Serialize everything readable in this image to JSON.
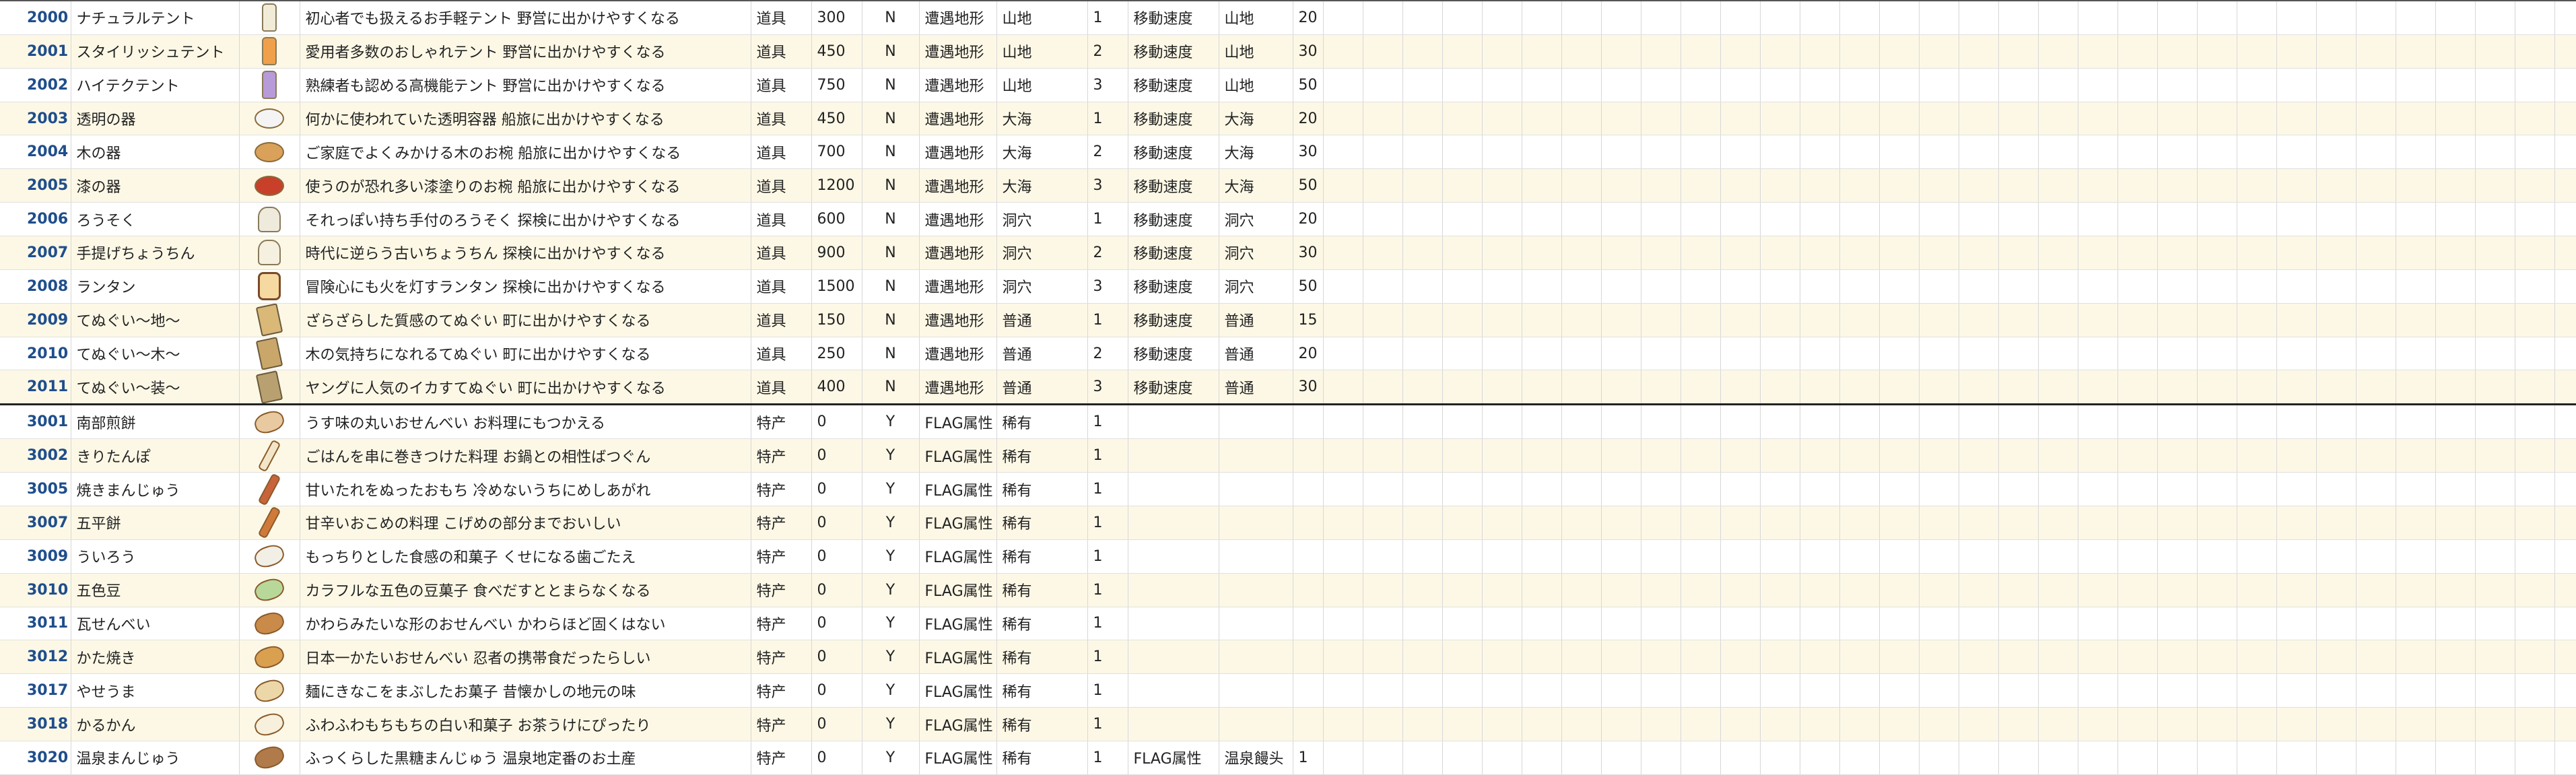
{
  "rows": [
    {
      "id": "2000",
      "name": "ナチュラルテント",
      "icon": "tent-bottle-icon",
      "iconColor": "#f1ecd8",
      "desc": "初心者でも扱えるお手軽テント 野営に出かけやすくなる",
      "type": "道具",
      "price": "300",
      "flag": "N",
      "cat": "遭遇地形",
      "terrain": "山地",
      "lv": "1",
      "effect": "移動速度",
      "target": "山地",
      "value": "20"
    },
    {
      "id": "2001",
      "name": "スタイリッシュテント",
      "icon": "tent-bottle-icon",
      "iconColor": "#f0a04a",
      "desc": "愛用者多数のおしゃれテント 野営に出かけやすくなる",
      "type": "道具",
      "price": "450",
      "flag": "N",
      "cat": "遭遇地形",
      "terrain": "山地",
      "lv": "2",
      "effect": "移動速度",
      "target": "山地",
      "value": "30"
    },
    {
      "id": "2002",
      "name": "ハイテクテント",
      "icon": "tent-bottle-icon",
      "iconColor": "#b79ad8",
      "desc": "熟練者も認める高機能テント 野営に出かけやすくなる",
      "type": "道具",
      "price": "750",
      "flag": "N",
      "cat": "遭遇地形",
      "terrain": "山地",
      "lv": "3",
      "effect": "移動速度",
      "target": "山地",
      "value": "50"
    },
    {
      "id": "2003",
      "name": "透明の器",
      "icon": "bowl-icon",
      "iconColor": "#f4f4f4",
      "desc": "何かに使われていた透明容器 船旅に出かけやすくなる",
      "type": "道具",
      "price": "450",
      "flag": "N",
      "cat": "遭遇地形",
      "terrain": "大海",
      "lv": "1",
      "effect": "移動速度",
      "target": "大海",
      "value": "20"
    },
    {
      "id": "2004",
      "name": "木の器",
      "icon": "bowl-icon",
      "iconColor": "#d9a15a",
      "desc": "ご家庭でよくみかける木のお椀 船旅に出かけやすくなる",
      "type": "道具",
      "price": "700",
      "flag": "N",
      "cat": "遭遇地形",
      "terrain": "大海",
      "lv": "2",
      "effect": "移動速度",
      "target": "大海",
      "value": "30"
    },
    {
      "id": "2005",
      "name": "漆の器",
      "icon": "bowl-icon",
      "iconColor": "#c8402a",
      "desc": "使うのが恐れ多い漆塗りのお椀 船旅に出かけやすくなる",
      "type": "道具",
      "price": "1200",
      "flag": "N",
      "cat": "遭遇地形",
      "terrain": "大海",
      "lv": "3",
      "effect": "移動速度",
      "target": "大海",
      "value": "50"
    },
    {
      "id": "2006",
      "name": "ろうそく",
      "icon": "candle-icon",
      "iconColor": "#eeeadc",
      "desc": "それっぽい持ち手付のろうそく 探検に出かけやすくなる",
      "type": "道具",
      "price": "600",
      "flag": "N",
      "cat": "遭遇地形",
      "terrain": "洞穴",
      "lv": "1",
      "effect": "移動速度",
      "target": "洞穴",
      "value": "20"
    },
    {
      "id": "2007",
      "name": "手提げちょうちん",
      "icon": "candle-icon",
      "iconColor": "#f5f0e0",
      "desc": "時代に逆らう古いちょうちん 探検に出かけやすくなる",
      "type": "道具",
      "price": "900",
      "flag": "N",
      "cat": "遭遇地形",
      "terrain": "洞穴",
      "lv": "2",
      "effect": "移動速度",
      "target": "洞穴",
      "value": "30"
    },
    {
      "id": "2008",
      "name": "ランタン",
      "icon": "lantern-icon",
      "iconColor": "#f6d9a0",
      "desc": "冒険心にも火を灯すランタン 探検に出かけやすくなる",
      "type": "道具",
      "price": "1500",
      "flag": "N",
      "cat": "遭遇地形",
      "terrain": "洞穴",
      "lv": "3",
      "effect": "移動速度",
      "target": "洞穴",
      "value": "50"
    },
    {
      "id": "2009",
      "name": "てぬぐい～地～",
      "icon": "towel-icon",
      "iconColor": "#d9b878",
      "desc": "ざらざらした質感のてぬぐい 町に出かけやすくなる",
      "type": "道具",
      "price": "150",
      "flag": "N",
      "cat": "遭遇地形",
      "terrain": "普通",
      "lv": "1",
      "effect": "移動速度",
      "target": "普通",
      "value": "15"
    },
    {
      "id": "2010",
      "name": "てぬぐい～木～",
      "icon": "towel-icon",
      "iconColor": "#c9a66a",
      "desc": "木の気持ちになれるてぬぐい 町に出かけやすくなる",
      "type": "道具",
      "price": "250",
      "flag": "N",
      "cat": "遭遇地形",
      "terrain": "普通",
      "lv": "2",
      "effect": "移動速度",
      "target": "普通",
      "value": "20"
    },
    {
      "id": "2011",
      "name": "てぬぐい～装～",
      "icon": "towel-icon",
      "iconColor": "#b8a070",
      "desc": "ヤングに人気のイカすてぬぐい 町に出かけやすくなる",
      "type": "道具",
      "price": "400",
      "flag": "N",
      "cat": "遭遇地形",
      "terrain": "普通",
      "lv": "3",
      "effect": "移動速度",
      "target": "普通",
      "value": "30"
    },
    {
      "id": "3001",
      "name": "南部煎餅",
      "icon": "food-icon",
      "iconColor": "#e8c9a0",
      "desc": "うす味の丸いおせんべい お料理にもつかえる",
      "type": "特产",
      "price": "0",
      "flag": "Y",
      "cat": "FLAG属性",
      "terrain": "稀有",
      "lv": "1",
      "effect": "",
      "target": "",
      "value": ""
    },
    {
      "id": "3002",
      "name": "きりたんぽ",
      "icon": "stick-icon",
      "iconColor": "#f3e6c8",
      "desc": "ごはんを串に巻きつけた料理 お鍋との相性ばつぐん",
      "type": "特产",
      "price": "0",
      "flag": "Y",
      "cat": "FLAG属性",
      "terrain": "稀有",
      "lv": "1",
      "effect": "",
      "target": "",
      "value": ""
    },
    {
      "id": "3005",
      "name": "焼きまんじゅう",
      "icon": "stick-icon",
      "iconColor": "#c8643a",
      "desc": "甘いたれをぬったおもち 冷めないうちにめしあがれ",
      "type": "特产",
      "price": "0",
      "flag": "Y",
      "cat": "FLAG属性",
      "terrain": "稀有",
      "lv": "1",
      "effect": "",
      "target": "",
      "value": ""
    },
    {
      "id": "3007",
      "name": "五平餅",
      "icon": "stick-icon",
      "iconColor": "#d07a3a",
      "desc": "甘辛いおこめの料理 こげめの部分までおいしい",
      "type": "特产",
      "price": "0",
      "flag": "Y",
      "cat": "FLAG属性",
      "terrain": "稀有",
      "lv": "1",
      "effect": "",
      "target": "",
      "value": ""
    },
    {
      "id": "3009",
      "name": "ういろう",
      "icon": "food-icon",
      "iconColor": "#f2efe6",
      "desc": "もっちりとした食感の和菓子 くせになる歯ごたえ",
      "type": "特产",
      "price": "0",
      "flag": "Y",
      "cat": "FLAG属性",
      "terrain": "稀有",
      "lv": "1",
      "effect": "",
      "target": "",
      "value": ""
    },
    {
      "id": "3010",
      "name": "五色豆",
      "icon": "food-icon",
      "iconColor": "#b8d89a",
      "desc": "カラフルな五色の豆菓子 食べだすととまらなくなる",
      "type": "特产",
      "price": "0",
      "flag": "Y",
      "cat": "FLAG属性",
      "terrain": "稀有",
      "lv": "1",
      "effect": "",
      "target": "",
      "value": ""
    },
    {
      "id": "3011",
      "name": "瓦せんべい",
      "icon": "food-icon",
      "iconColor": "#c98a4a",
      "desc": "かわらみたいな形のおせんべい かわらほど固くはない",
      "type": "特产",
      "price": "0",
      "flag": "Y",
      "cat": "FLAG属性",
      "terrain": "稀有",
      "lv": "1",
      "effect": "",
      "target": "",
      "value": ""
    },
    {
      "id": "3012",
      "name": "かた焼き",
      "icon": "food-icon",
      "iconColor": "#d9a050",
      "desc": "日本一かたいおせんべい 忍者の携帯食だったらしい",
      "type": "特产",
      "price": "0",
      "flag": "Y",
      "cat": "FLAG属性",
      "terrain": "稀有",
      "lv": "1",
      "effect": "",
      "target": "",
      "value": ""
    },
    {
      "id": "3017",
      "name": "やせうま",
      "icon": "food-icon",
      "iconColor": "#ecd7a8",
      "desc": "麺にきなこをまぶしたお菓子 昔懐かしの地元の味",
      "type": "特产",
      "price": "0",
      "flag": "Y",
      "cat": "FLAG属性",
      "terrain": "稀有",
      "lv": "1",
      "effect": "",
      "target": "",
      "value": ""
    },
    {
      "id": "3018",
      "name": "かるかん",
      "icon": "food-icon",
      "iconColor": "#f6f0dc",
      "desc": "ふわふわもちもちの白い和菓子 お茶うけにぴったり",
      "type": "特产",
      "price": "0",
      "flag": "Y",
      "cat": "FLAG属性",
      "terrain": "稀有",
      "lv": "1",
      "effect": "",
      "target": "",
      "value": ""
    },
    {
      "id": "3020",
      "name": "温泉まんじゅう",
      "icon": "food-icon",
      "iconColor": "#b07a4a",
      "desc": "ふっくらした黒糖まんじゅう 温泉地定番のお土産",
      "type": "特产",
      "price": "0",
      "flag": "Y",
      "cat": "FLAG属性",
      "terrain": "稀有",
      "lv": "1",
      "effect": "FLAG属性",
      "target": "温泉饅头",
      "value": "1"
    }
  ]
}
